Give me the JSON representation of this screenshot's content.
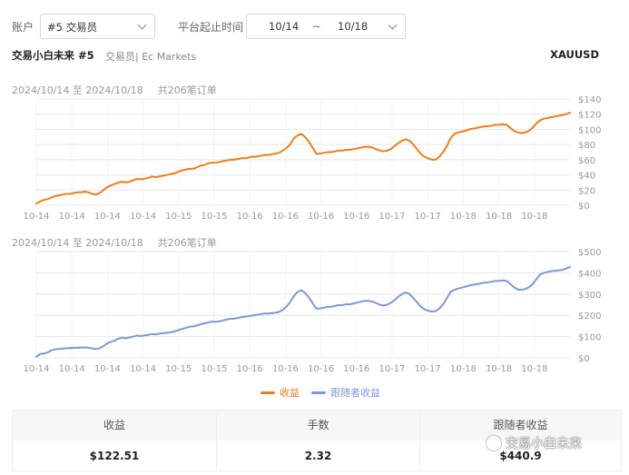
{
  "filters": {
    "account_label": "账户",
    "account_value": "#5 交易员",
    "period_label": "平台起止时间",
    "start_date": "10/14",
    "separator": "~",
    "end_date": "10/18"
  },
  "info": {
    "trader_name": "交易小白未来 #5",
    "broker": "交易员| Ec Markets",
    "symbol": "XAUUSD"
  },
  "chart1_header": {
    "range": "2024/10/14 至 2024/10/18",
    "count": "共206笔订单"
  },
  "chart2_header": {
    "range": "2024/10/14 至 2024/10/18",
    "count": "共206笔订单"
  },
  "legend": {
    "profit": "收益",
    "follower": "跟随者收益"
  },
  "stats": {
    "profit_label": "收益",
    "profit_value": "$122.51",
    "lots_label": "手数",
    "lots_value": "2.32",
    "follower_label": "跟随者收益",
    "follower_value": "$440.9"
  },
  "watermark": "交易小白未来",
  "colors": {
    "profit": "#f07d1a",
    "follower": "#7b98d8",
    "grid": "#e8e8e8",
    "axis_text": "#999999"
  },
  "chart_data": [
    {
      "type": "line",
      "series": [
        {
          "name": "收益",
          "color": "#f07d1a",
          "values": [
            2,
            5,
            7,
            8,
            10,
            12,
            13,
            14,
            15,
            15,
            16,
            17,
            17,
            18,
            17,
            15,
            14,
            16,
            20,
            24,
            26,
            28,
            30,
            31,
            30,
            31,
            33,
            35,
            34,
            35,
            36,
            38,
            37,
            38,
            39,
            40,
            41,
            42,
            44,
            46,
            47,
            48,
            48,
            50,
            52,
            53,
            55,
            56,
            56,
            57,
            58,
            59,
            60,
            60,
            61,
            62,
            62,
            63,
            64,
            64,
            65,
            66,
            66,
            67,
            68,
            69,
            72,
            75,
            80,
            88,
            92,
            94,
            90,
            84,
            76,
            68,
            68,
            69,
            70,
            70,
            71,
            72,
            72,
            73,
            73,
            74,
            75,
            76,
            77,
            77,
            76,
            74,
            72,
            71,
            72,
            74,
            78,
            82,
            85,
            87,
            85,
            80,
            74,
            68,
            64,
            62,
            60,
            60,
            64,
            70,
            78,
            88,
            94,
            96,
            97,
            98,
            100,
            101,
            102,
            103,
            104,
            104,
            105,
            106,
            106,
            107,
            106,
            102,
            98,
            96,
            95,
            96,
            98,
            102,
            108,
            112,
            114,
            115,
            116,
            117,
            118,
            119,
            120,
            122
          ]
        }
      ],
      "x_tick_labels": [
        "10-14",
        "10-14",
        "10-14",
        "10-14",
        "10-15",
        "10-15",
        "10-16",
        "10-16",
        "10-16",
        "10-16",
        "10-17",
        "10-17",
        "10-18",
        "10-18",
        "10-18"
      ],
      "y_ticks": [
        "$0",
        "$20",
        "$40",
        "$60",
        "$80",
        "$100",
        "$120",
        "$140"
      ],
      "ylim": [
        0,
        140
      ]
    },
    {
      "type": "line",
      "series": [
        {
          "name": "跟随者收益",
          "color": "#7b98d8",
          "values": [
            5,
            18,
            20,
            25,
            35,
            40,
            42,
            44,
            45,
            46,
            47,
            48,
            48,
            49,
            48,
            44,
            42,
            45,
            55,
            68,
            75,
            82,
            90,
            95,
            92,
            96,
            100,
            105,
            102,
            106,
            108,
            112,
            110,
            114,
            116,
            118,
            120,
            124,
            130,
            136,
            140,
            146,
            148,
            152,
            158,
            162,
            166,
            170,
            170,
            172,
            176,
            180,
            184,
            184,
            188,
            192,
            194,
            196,
            200,
            202,
            205,
            208,
            208,
            210,
            212,
            216,
            226,
            240,
            262,
            290,
            310,
            318,
            305,
            285,
            258,
            232,
            232,
            236,
            240,
            240,
            244,
            248,
            248,
            252,
            252,
            256,
            260,
            264,
            268,
            268,
            265,
            258,
            250,
            246,
            250,
            258,
            272,
            288,
            300,
            308,
            300,
            282,
            262,
            242,
            228,
            222,
            218,
            220,
            232,
            252,
            280,
            310,
            320,
            326,
            330,
            335,
            340,
            344,
            346,
            350,
            354,
            355,
            358,
            362,
            362,
            364,
            362,
            348,
            332,
            322,
            320,
            324,
            332,
            348,
            370,
            392,
            400,
            404,
            408,
            410,
            412,
            414,
            420,
            428
          ]
        }
      ],
      "x_tick_labels": [
        "10-14",
        "10-14",
        "10-14",
        "10-14",
        "10-15",
        "10-15",
        "10-16",
        "10-16",
        "10-16",
        "10-16",
        "10-17",
        "10-17",
        "10-18",
        "10-18",
        "10-18"
      ],
      "y_ticks": [
        "$0",
        "$100",
        "$200",
        "$300",
        "$400",
        "$500"
      ],
      "ylim": [
        0,
        500
      ]
    }
  ]
}
